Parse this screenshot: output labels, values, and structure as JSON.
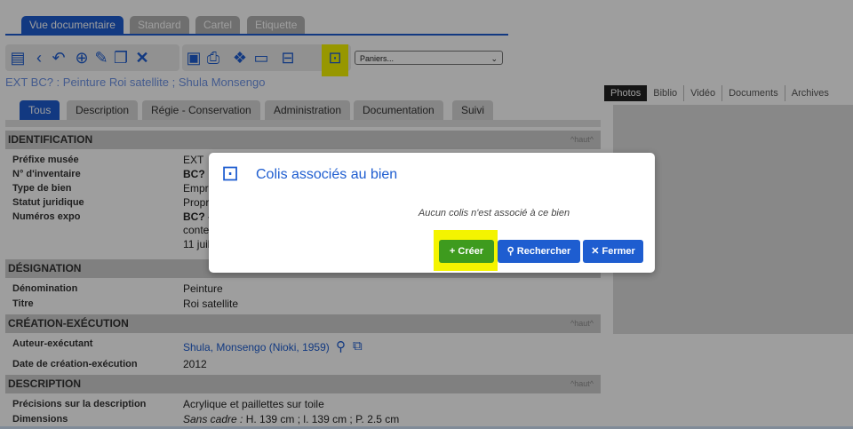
{
  "view_tabs": [
    {
      "label": "Vue documentaire",
      "active": true
    },
    {
      "label": "Standard",
      "active": false
    },
    {
      "label": "Cartel",
      "active": false
    },
    {
      "label": "Etiquette",
      "active": false
    }
  ],
  "toolbar": {
    "icons": [
      "list-icon",
      "back-icon",
      "undo-icon",
      "add-icon",
      "edit-icon",
      "copy-icon",
      "delete-icon",
      "id-card-icon",
      "print-icon",
      "boxes-icon",
      "folder-icon",
      "toolbox-icon",
      "cart-icon"
    ],
    "basket_select": "Paniers..."
  },
  "page_title": "EXT BC? : Peinture Roi satellite ; Shula Monsengo",
  "section_tabs": [
    "Tous",
    "Description",
    "Régie - Conservation",
    "Administration",
    "Documentation",
    "Suivi"
  ],
  "sections": {
    "identification": {
      "title": "IDENTIFICATION",
      "haut": "^haut^",
      "rows": [
        {
          "label": "Préfixe musée",
          "value": "EXT"
        },
        {
          "label": "N° d'inventaire",
          "value": "BC?"
        },
        {
          "label": "Type de bien",
          "value": "Empr"
        },
        {
          "label": "Statut juridique",
          "value": "Propr"
        },
        {
          "label": "Numéros expo",
          "value": "BC? -"
        }
      ],
      "extra_lines": [
        "conte",
        "11 juil"
      ]
    },
    "designation": {
      "title": "DÉSIGNATION",
      "rows": [
        {
          "label": "Dénomination",
          "value": "Peinture"
        },
        {
          "label": "Titre",
          "value": "Roi satellite"
        }
      ]
    },
    "creation": {
      "title": "CRÉATION-EXÉCUTION",
      "haut": "^haut^",
      "rows": [
        {
          "label": "Auteur-exécutant",
          "value": "Shula, Monsengo (Nioki, 1959)"
        },
        {
          "label": "Date de création-exécution",
          "value": "2012"
        }
      ]
    },
    "description": {
      "title": "DESCRIPTION",
      "haut": "^haut^",
      "rows": [
        {
          "label": "Précisions sur la description",
          "value": "Acrylique et paillettes sur toile"
        },
        {
          "label": "Dimensions",
          "value_italic": "Sans cadre :",
          "value": " H. 139 cm ;  l. 139 cm ;  P. 2.5 cm"
        }
      ]
    }
  },
  "right_tabs": [
    "Photos",
    "Biblio",
    "Vidéo",
    "Documents",
    "Archives"
  ],
  "modal": {
    "title": "Colis associés au bien",
    "message": "Aucun colis n'est associé à ce bien",
    "create_label": "Créer",
    "search_label": "Rechercher",
    "close_label": "Fermer",
    "colors": {
      "create": "#3e9b1e",
      "search": "#1e5dd0",
      "close": "#1e5dd0",
      "highlight": "#f4f400"
    }
  }
}
